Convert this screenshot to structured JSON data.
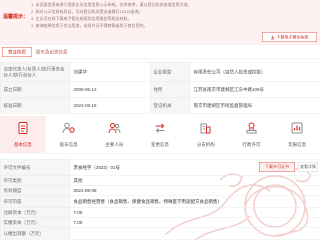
{
  "notice": {
    "label": "温馨提示：",
    "lines": [
      "1. 本页面信息来源于国家企业信用信息公示系统，仅供参考，请以登记机关核准信息为准。",
      "2. 如对公示信息有异议，可向登记机关提出或拨打12315咨询。",
      "3. 企业可在线下载电子营业执照及信用报告等相关材料。",
      "4. 查询结果仅用于合法用途，未经许可不得转载或用于商业目的。"
    ],
    "download_button": "下载电子营业执照",
    "download_icon": "download-icon"
  },
  "tabs": [
    {
      "label": "营业执照",
      "active": true
    },
    {
      "label": "股东及出资信息",
      "active": false
    }
  ],
  "license_table": {
    "rows": [
      {
        "label1": "法定代表人/负责人/执行事务合伙人/执行合伙人",
        "value1": "刘建华",
        "label2": "企业类型",
        "value2": "有限责任公司（自然人投资或控股）"
      },
      {
        "label1": "成立日期",
        "value1": "2008-05-12",
        "label2": "住所",
        "value2": "江苏省南京市建邺区江东中路108号"
      },
      {
        "label1": "核准日期",
        "value1": "2023-06-16",
        "label2": "登记机关",
        "value2": "南京市建邺区市场监督管理局"
      }
    ]
  },
  "modules": [
    {
      "label": "基本信息",
      "icon": "document-icon",
      "active": true
    },
    {
      "label": "股东信息",
      "icon": "shareholder-icon",
      "active": false
    },
    {
      "label": "主要人员",
      "icon": "people-icon",
      "active": false
    },
    {
      "label": "变更信息",
      "icon": "change-icon",
      "active": false
    },
    {
      "label": "分支机构",
      "icon": "building-icon",
      "active": false
    },
    {
      "label": "行政许可",
      "icon": "stamp-icon",
      "active": false
    },
    {
      "label": "年报信息",
      "icon": "report-icon",
      "active": false
    }
  ],
  "permit_table": {
    "buttons": {
      "download": "下载许可证书",
      "view": "查看详情"
    },
    "rows": [
      {
        "label": "许可文件编号",
        "value": "苏食经字（2023）01号"
      },
      {
        "label": "许可类别",
        "value": "其他"
      },
      {
        "label": "有效期自",
        "value": "2021-05-08"
      },
      {
        "label": "许可内容",
        "value": "食品销售经营者（食品销售、保健食品销售、特殊医学用途配方食品销售）"
      },
      {
        "label": "注册资本（万元）",
        "value": "7.00"
      },
      {
        "label": "实缴资本（万元）",
        "value": "7.00"
      },
      {
        "label": "认缴出资额（万元）",
        "value": ""
      }
    ]
  },
  "colors": {
    "accent": "#d9281f",
    "notice_background": "#fdf1f1",
    "label_background": "#f6f6f6",
    "active_module_background": "#fdecec",
    "watermark": "#e9a7a2"
  }
}
